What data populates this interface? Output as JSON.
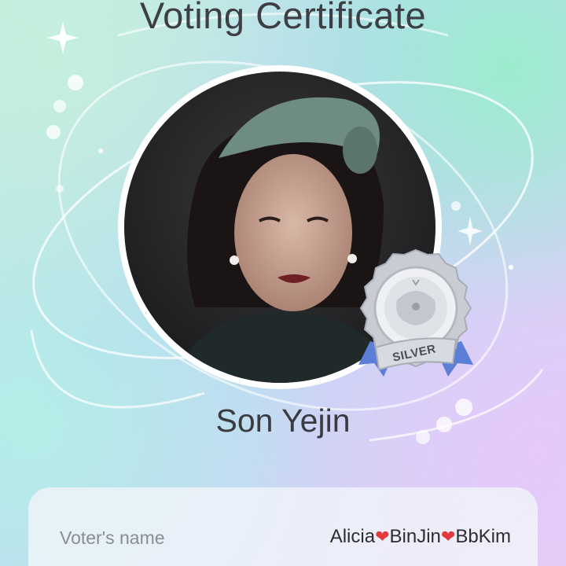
{
  "certificate": {
    "title": "Voting Certificate",
    "candidate_name": "Son Yejin",
    "badge_label": "SILVER",
    "voter_label": "Voter's name",
    "voter_value": {
      "part1": "Alicia",
      "heart1": "❤",
      "part2": "BinJin",
      "heart2": "❤",
      "part3": "BbKim"
    }
  },
  "colors": {
    "title": "#3d3f44",
    "heart": "#e23a3a",
    "badge_ribbon": "#5b7fd6",
    "badge_silver": "#b9bcc4"
  },
  "icons": {
    "sparkle": "sparkle-icon",
    "moon": "crescent-moon-icon",
    "badge": "silver-medal-icon"
  }
}
